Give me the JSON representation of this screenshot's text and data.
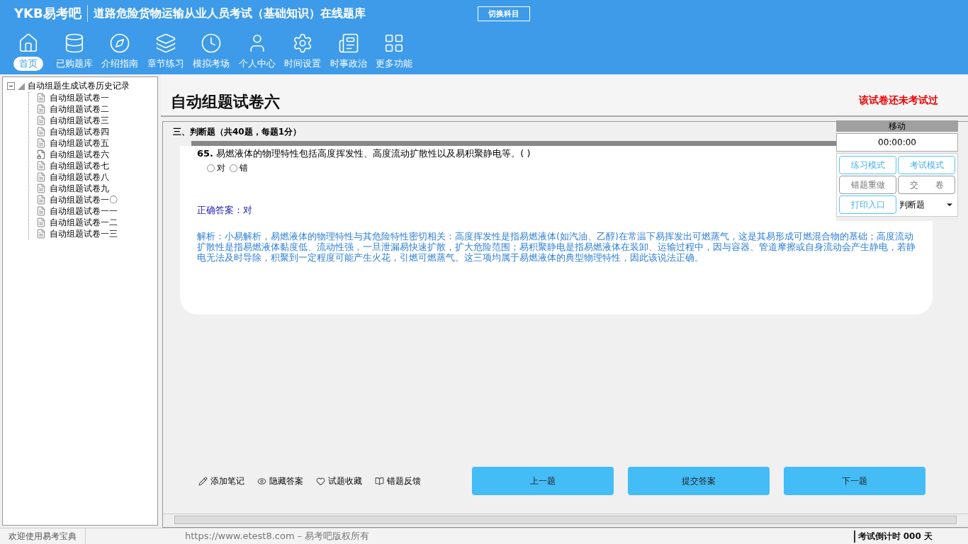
{
  "header": {
    "logo": "YKB易考吧",
    "title": "道路危险货物运输从业人员考试（基础知识）在线题库",
    "switch_button": "切换科目"
  },
  "nav": [
    {
      "label": "首页",
      "selected": true
    },
    {
      "label": "已购题库",
      "selected": false
    },
    {
      "label": "介绍指南",
      "selected": false
    },
    {
      "label": "章节练习",
      "selected": false
    },
    {
      "label": "模拟考场",
      "selected": false
    },
    {
      "label": "个人中心",
      "selected": false
    },
    {
      "label": "时间设置",
      "selected": false
    },
    {
      "label": "时事政治",
      "selected": false
    },
    {
      "label": "更多功能",
      "selected": false
    }
  ],
  "tree": {
    "label": "自动组题生成试卷历史记录",
    "expanded": true,
    "children": [
      {
        "label": "自动组题试卷一",
        "selected": false
      },
      {
        "label": "自动组题试卷二",
        "selected": false
      },
      {
        "label": "自动组题试卷三",
        "selected": false
      },
      {
        "label": "自动组题试卷四",
        "selected": false
      },
      {
        "label": "自动组题试卷五",
        "selected": false
      },
      {
        "label": "自动组题试卷六",
        "selected": true
      },
      {
        "label": "自动组题试卷七",
        "selected": false
      },
      {
        "label": "自动组题试卷八",
        "selected": false
      },
      {
        "label": "自动组题试卷九",
        "selected": false
      },
      {
        "label": "自动组题试卷一〇",
        "selected": false
      },
      {
        "label": "自动组题试卷一一",
        "selected": false
      },
      {
        "label": "自动组题试卷一二",
        "selected": false
      },
      {
        "label": "自动组题试卷一三",
        "selected": false
      }
    ]
  },
  "paper": {
    "title": "自动组题试卷六",
    "status": "该试卷还未考试过",
    "section": "三、判断题（共40题，每题1分）"
  },
  "question": {
    "number": "65.",
    "text": "易燃液体的物理特性包括高度挥发性、高度流动扩散性以及易积聚静电等。( )",
    "options": [
      {
        "label": "对",
        "selected": false
      },
      {
        "label": "错",
        "selected": false
      }
    ],
    "answer": "正确答案：对",
    "analysis": "解析：小易解析，易燃液体的物理特性与其危险特性密切相关：高度挥发性是指易燃液体(如汽油、乙醇)在常温下易挥发出可燃蒸气，这是其易形成可燃混合物的基础；高度流动扩散性是指易燃液体黏度低、流动性强，一旦泄漏易快速扩散，扩大危险范围；易积聚静电是指易燃液体在装卸、运输过程中，因与容器、管道摩擦或自身流动会产生静电，若静电无法及时导除，积聚到一定程度可能产生火花，引燃可燃蒸气。这三项均属于易燃液体的典型物理特性，因此该说法正确。"
  },
  "widget": {
    "title": "移动",
    "timer": "00:00:00",
    "buttons": [
      {
        "label": "练习模式",
        "kind": "accent"
      },
      {
        "label": "考试模式",
        "kind": "accent"
      },
      {
        "label": "错题重做",
        "kind": "plain"
      },
      {
        "label": "交　　卷",
        "kind": "plain"
      },
      {
        "label": "打印入口",
        "kind": "accent"
      }
    ],
    "dropdown": "判断题"
  },
  "tools": [
    "添加笔记",
    "隐藏答案",
    "试题收藏",
    "错题反馈"
  ],
  "actions": [
    "上一题",
    "提交答案",
    "下一题"
  ],
  "status_bar": {
    "welcome": "欢迎使用易考宝典",
    "copyright": "https://www.etest8.com – 易考吧版权所有",
    "countdown": "考试倒计时 000 天"
  }
}
